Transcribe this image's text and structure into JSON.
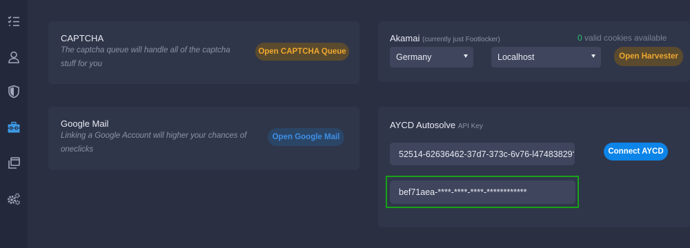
{
  "sidebar": {
    "items": [
      {
        "icon": "checklist-icon"
      },
      {
        "icon": "user-icon"
      },
      {
        "icon": "shield-icon"
      },
      {
        "icon": "toolbox-icon",
        "active": true
      },
      {
        "icon": "windows-icon"
      },
      {
        "icon": "gears-icon"
      }
    ]
  },
  "captcha": {
    "title": "CAPTCHA",
    "desc_line1": "The captcha queue will handle all of the captcha",
    "desc_line2": "stuff for you",
    "button": "Open CAPTCHA Queue"
  },
  "akamai": {
    "title": "Akamai",
    "subtitle": "(currently just Footlocker)",
    "cookie_count": "0",
    "cookie_label": "valid cookies available",
    "region": "Germany",
    "host": "Localhost",
    "button": "Open Harvester"
  },
  "gmail": {
    "title": "Google Mail",
    "desc_line1": "Linking a Google Account will higher your chances of",
    "desc_line2": "oneclicks",
    "button": "Open Google Mail"
  },
  "aycd": {
    "title": "AYCD Autosolve",
    "subtitle": "API Key",
    "api_key": "52514-62636462-37d7-373c-6v76-l47483829‘",
    "button": "Connect AYCD",
    "access_token": "bef71aea-****-****-****-************"
  },
  "colors": {
    "accent_orange": "#f0a92e",
    "accent_blue": "#0d84e8",
    "highlight_green": "#18a318"
  }
}
